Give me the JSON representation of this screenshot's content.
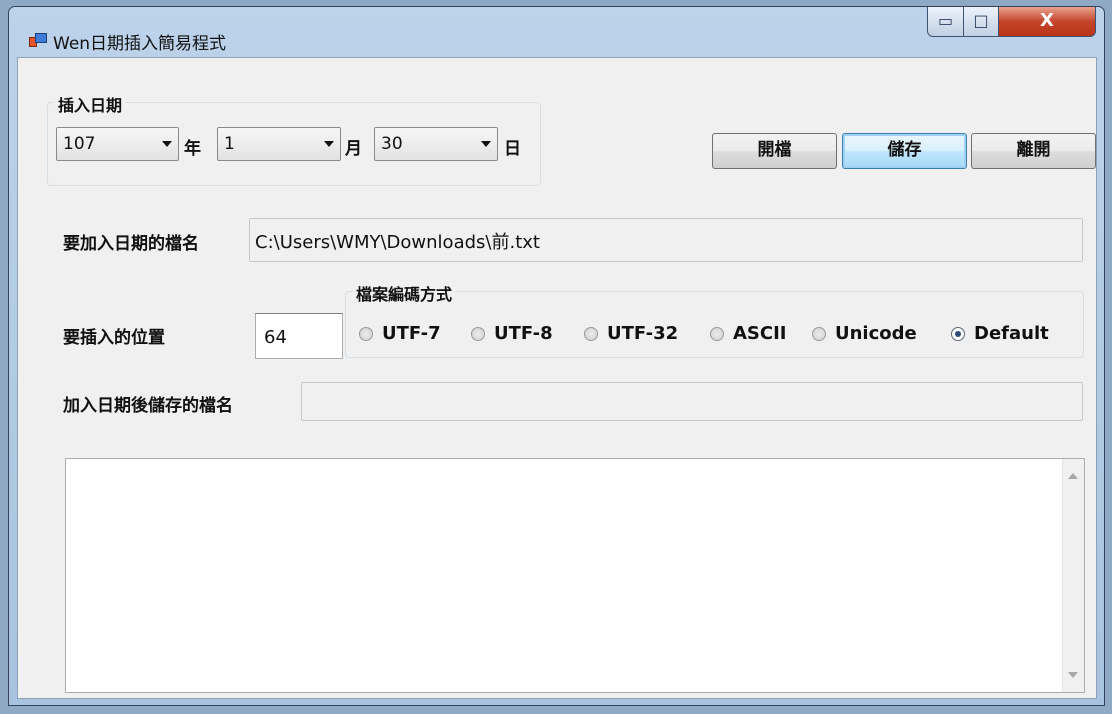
{
  "window": {
    "title": "Wen日期插入簡易程式",
    "min_glyph": "▭",
    "max_glyph": "□",
    "close_glyph": "X"
  },
  "date_group": {
    "title": "插入日期",
    "year": "107",
    "year_unit": "年",
    "month": "1",
    "month_unit": "月",
    "day": "30",
    "day_unit": "日"
  },
  "buttons": {
    "open": "開檔",
    "save": "儲存",
    "exit": "離開"
  },
  "file": {
    "label": "要加入日期的檔名",
    "value": "C:\\Users\\WMY\\Downloads\\前.txt"
  },
  "position": {
    "label": "要插入的位置",
    "value": "64"
  },
  "encoding": {
    "title": "檔案編碼方式",
    "options": [
      "UTF-7",
      "UTF-8",
      "UTF-32",
      "ASCII",
      "Unicode",
      "Default"
    ],
    "selected": "Default"
  },
  "output": {
    "label": "加入日期後儲存的檔名",
    "value": ""
  },
  "colors": {
    "titlebar": "#bcd3ea",
    "client": "#f0f0f0",
    "close": "#c4452b",
    "focus_border": "#3c7fb1"
  }
}
